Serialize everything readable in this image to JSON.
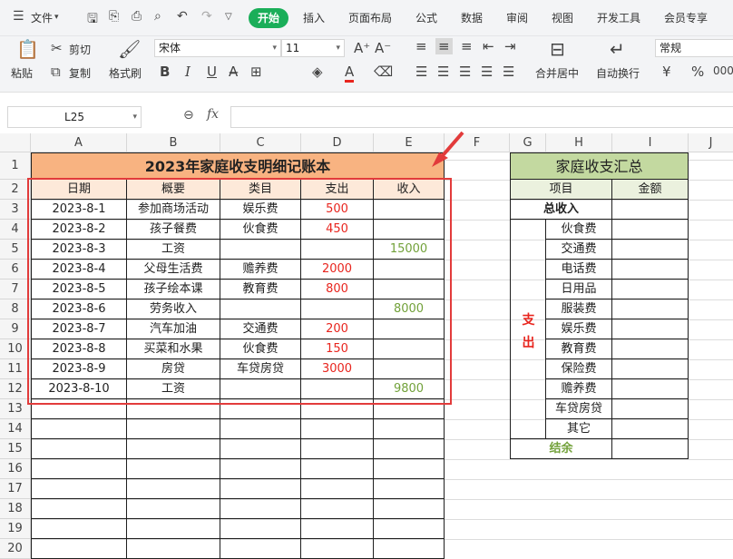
{
  "menubar": {
    "file": "文件",
    "tabs": [
      "开始",
      "插入",
      "页面布局",
      "公式",
      "数据",
      "审阅",
      "视图",
      "开发工具",
      "会员专享"
    ]
  },
  "ribbon": {
    "paste": "粘贴",
    "cut": "剪切",
    "copy": "复制",
    "format_painter": "格式刷",
    "font_name": "宋体",
    "font_size": "11",
    "merge_center": "合并居中",
    "wrap_text": "自动换行",
    "number_format": "常规",
    "currency_symbol": "¥",
    "percent_symbol": "%",
    "thousands_symbol": "000"
  },
  "formula_bar": {
    "cell_ref": "L25",
    "fx": "fx"
  },
  "columns": [
    "A",
    "B",
    "C",
    "D",
    "E",
    "F",
    "G",
    "H",
    "I",
    "J"
  ],
  "rows": [
    "1",
    "2",
    "3",
    "4",
    "5",
    "6",
    "7",
    "8",
    "9",
    "10",
    "11",
    "12",
    "13",
    "14",
    "15",
    "16",
    "17",
    "18",
    "19",
    "20"
  ],
  "ledger": {
    "title": "2023年家庭收支明细记账本",
    "headers": [
      "日期",
      "概要",
      "类目",
      "支出",
      "收入"
    ],
    "records": [
      {
        "date": "2023-8-1",
        "summary": "参加商场活动",
        "category": "娱乐费",
        "expense": "500",
        "income": ""
      },
      {
        "date": "2023-8-2",
        "summary": "孩子餐费",
        "category": "伙食费",
        "expense": "450",
        "income": ""
      },
      {
        "date": "2023-8-3",
        "summary": "工资",
        "category": "",
        "expense": "",
        "income": "15000"
      },
      {
        "date": "2023-8-4",
        "summary": "父母生活费",
        "category": "赡养费",
        "expense": "2000",
        "income": ""
      },
      {
        "date": "2023-8-5",
        "summary": "孩子绘本课",
        "category": "教育费",
        "expense": "800",
        "income": ""
      },
      {
        "date": "2023-8-6",
        "summary": "劳务收入",
        "category": "",
        "expense": "",
        "income": "8000"
      },
      {
        "date": "2023-8-7",
        "summary": "汽车加油",
        "category": "交通费",
        "expense": "200",
        "income": ""
      },
      {
        "date": "2023-8-8",
        "summary": "买菜和水果",
        "category": "伙食费",
        "expense": "150",
        "income": ""
      },
      {
        "date": "2023-8-9",
        "summary": "房贷",
        "category": "车贷房贷",
        "expense": "3000",
        "income": ""
      },
      {
        "date": "2023-8-10",
        "summary": "工资",
        "category": "",
        "expense": "",
        "income": "9800"
      }
    ]
  },
  "summary": {
    "title": "家庭收支汇总",
    "col_item": "项目",
    "col_amount": "金额",
    "total_income": "总收入",
    "expense_label_1": "支",
    "expense_label_2": "出",
    "expense_items": [
      "伙食费",
      "交通费",
      "电话费",
      "日用品",
      "服装费",
      "娱乐费",
      "教育费",
      "保险费",
      "赡养费",
      "车贷房贷",
      "其它"
    ],
    "balance": "结余"
  },
  "colors": {
    "title_fill": "#f8b381",
    "header_fill": "#fde9d9",
    "summary_title_fill": "#c3d9a0",
    "summary_header_fill": "#ebf1de",
    "accent_green": "#1aae59",
    "expense_red": "#e8251e",
    "income_green": "#72a13a",
    "selection_red": "#e23b3b"
  }
}
